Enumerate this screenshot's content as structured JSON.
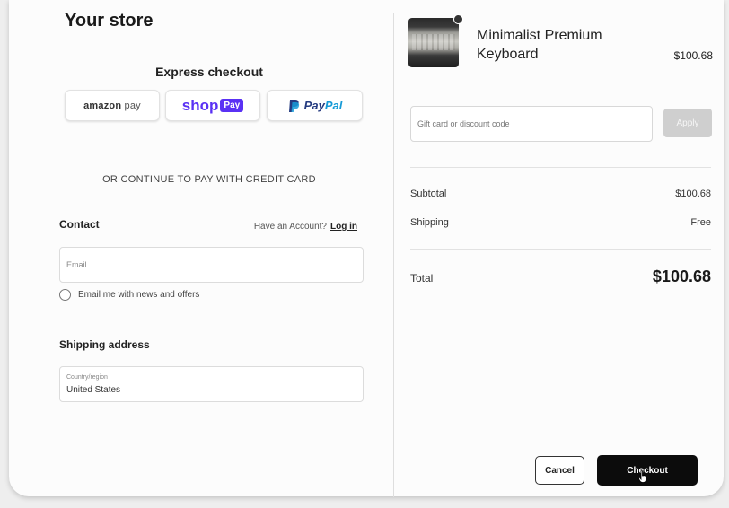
{
  "store": {
    "title": "Your store"
  },
  "express": {
    "heading": "Express checkout",
    "amazon_pay": {
      "brand": "amazon",
      "suffix": "pay"
    },
    "shop_pay": {
      "brand": "shop",
      "badge": "Pay"
    },
    "paypal": {
      "pay": "Pay",
      "pal": "Pal"
    }
  },
  "or_text": "OR CONTINUE TO PAY WITH CREDIT CARD",
  "contact": {
    "heading": "Contact",
    "have_account": "Have an Account?",
    "login": "Log in",
    "email_placeholder": "Email",
    "newsletter_label": "Email me with news and offers"
  },
  "shipping": {
    "heading": "Shipping address",
    "country_label": "Country/region",
    "country_value": "United States"
  },
  "order": {
    "product_name": "Minimalist Premium Keyboard",
    "product_price": "$100.68",
    "gift_placeholder": "Gift card or discount code",
    "apply_label": "Apply",
    "subtotal_label": "Subtotal",
    "subtotal_value": "$100.68",
    "shipping_label": "Shipping",
    "shipping_value": "Free",
    "total_label": "Total",
    "total_value": "$100.68"
  },
  "actions": {
    "cancel_label": "Cancel",
    "checkout_label": "Checkout"
  },
  "colors": {
    "shop_pay_purple": "#5a31f4",
    "paypal_dark_blue": "#253b80",
    "paypal_light_blue": "#179bd7",
    "checkout_bg": "#0c0c0c",
    "apply_disabled": "#cfcfcf"
  }
}
